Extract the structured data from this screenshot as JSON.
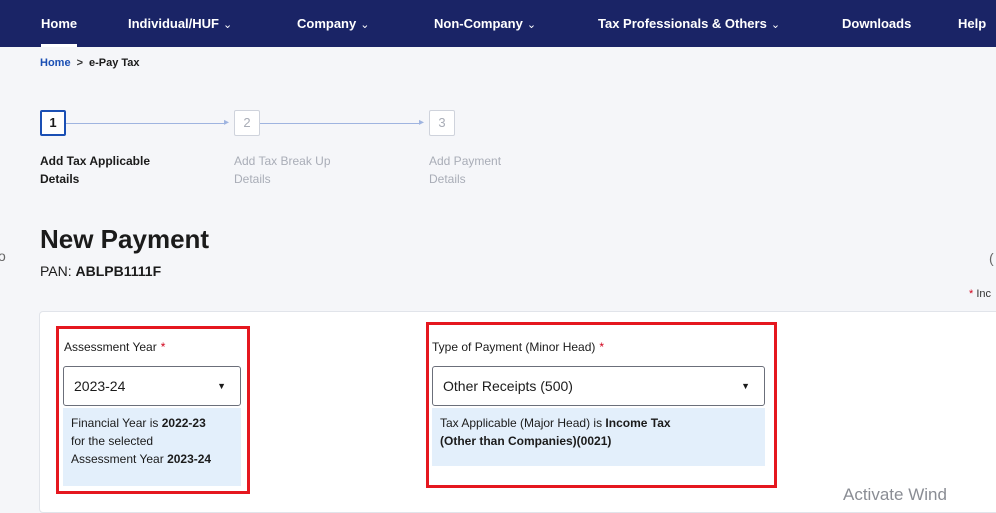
{
  "nav": {
    "items": [
      {
        "label": "Home",
        "dropdown": false,
        "active": true
      },
      {
        "label": "Individual/HUF",
        "dropdown": true
      },
      {
        "label": "Company",
        "dropdown": true
      },
      {
        "label": "Non-Company",
        "dropdown": true
      },
      {
        "label": "Tax Professionals & Others",
        "dropdown": true
      },
      {
        "label": "Downloads",
        "dropdown": false
      },
      {
        "label": "Help",
        "dropdown": false
      }
    ],
    "chevron": "⌄"
  },
  "breadcrumb": {
    "home": "Home",
    "separator": ">",
    "current": "e-Pay Tax"
  },
  "stepper": {
    "steps": [
      {
        "number": "1",
        "line1": "Add Tax Applicable",
        "line2": "Details",
        "state": "active"
      },
      {
        "number": "2",
        "line1": "Add Tax Break Up",
        "line2": "Details",
        "state": "inactive"
      },
      {
        "number": "3",
        "line1": "Add Payment",
        "line2": "Details",
        "state": "inactive"
      }
    ]
  },
  "page": {
    "title": "New Payment",
    "pan_label": "PAN:",
    "pan_value": "ABLPB1111F",
    "indicates_star": "*",
    "indicates_text": "Inc"
  },
  "assessment_year": {
    "label": "Assessment Year",
    "required": "*",
    "value": "2023-24",
    "info_prefix": "Financial Year is",
    "info_fy": "2022-23",
    "info_middle": "for the selected",
    "info_ay_label": "Assessment Year",
    "info_ay": "2023-24"
  },
  "type_of_payment": {
    "label": "Type of Payment (Minor Head)",
    "required": "*",
    "value": "Other Receipts (500)",
    "info_prefix": "Tax Applicable (Major Head) is",
    "info_bold_1": "Income Tax",
    "info_bold_2": "(Other than Companies)(0021)"
  },
  "watermark": "Activate Wind",
  "colors": {
    "nav_bg": "#1a2466",
    "accent": "#1a4fb4",
    "required": "#d0021b",
    "highlight": "#e5171f",
    "info_bg": "#e3effb"
  },
  "icons": {
    "dropdown": "caret-down-icon",
    "step_arrow": "arrow-right-icon"
  }
}
